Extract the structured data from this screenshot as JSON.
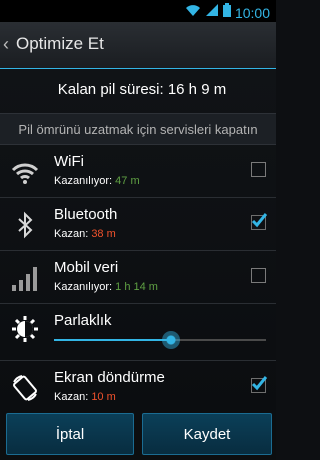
{
  "status_bar": {
    "time": "10:00"
  },
  "action_bar": {
    "back_glyph": "‹",
    "title": "Optimize Et"
  },
  "battery": {
    "text": "Kalan pil süresi: 16 h 9 m"
  },
  "section_header": "Pil ömrünü uzatmak için servisleri kapatın",
  "services": [
    {
      "name": "WiFi",
      "sub_label": "Kazanılıyor:",
      "sub_value": "47 m",
      "sub_color": "green",
      "checked": false,
      "icon": "wifi-icon"
    },
    {
      "name": "Bluetooth",
      "sub_label": "Kazan:",
      "sub_value": "38 m",
      "sub_color": "red",
      "checked": true,
      "icon": "bluetooth-icon"
    },
    {
      "name": "Mobil veri",
      "sub_label": "Kazanılıyor:",
      "sub_value": "1 h 14 m",
      "sub_color": "green",
      "checked": false,
      "icon": "signal-bars-icon"
    },
    {
      "name": "Parlaklık",
      "slider_value": 0.55,
      "icon": "brightness-icon"
    },
    {
      "name": "Ekran döndürme",
      "sub_label": "Kazan:",
      "sub_value": "10 m",
      "sub_color": "red",
      "checked": true,
      "icon": "screen-rotation-icon"
    }
  ],
  "buttons": {
    "cancel": "İptal",
    "save": "Kaydet"
  },
  "colors": {
    "accent": "#33b5e5",
    "green": "#5fa043",
    "red": "#f0522c"
  }
}
